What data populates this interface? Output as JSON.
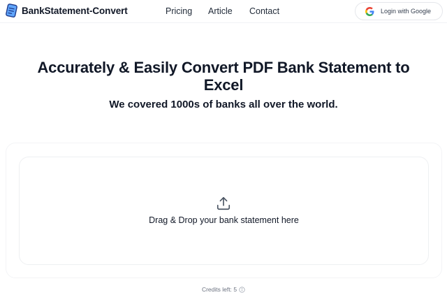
{
  "brand": {
    "name": "BankStatement-Convert",
    "icon": "document-icon",
    "accent": "#2563eb"
  },
  "nav": {
    "pricing": "Pricing",
    "article": "Article",
    "contact": "Contact"
  },
  "login": {
    "label": "Login with Google",
    "icon": "google-icon"
  },
  "hero": {
    "title": "Accurately & Easily Convert PDF Bank Statement to Excel",
    "subtitle": "We covered 1000s of banks all over the world."
  },
  "upload": {
    "prompt": "Drag & Drop your bank statement here",
    "icon": "upload-icon"
  },
  "credits": {
    "label": "Credits left:",
    "value": "5",
    "icon": "info-icon"
  }
}
